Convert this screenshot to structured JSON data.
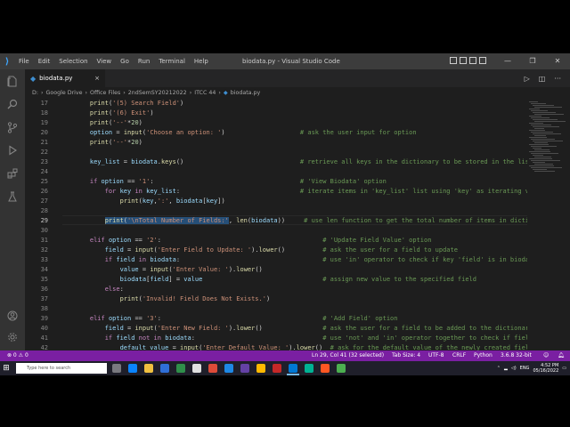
{
  "titlebar": {
    "menu": [
      "File",
      "Edit",
      "Selection",
      "View",
      "Go",
      "Run",
      "Terminal",
      "Help"
    ],
    "window_title": "biodata.py - Visual Studio Code",
    "minimize": "—",
    "maximize": "❐",
    "close": "✕"
  },
  "tab": {
    "name": "biodata.py",
    "close": "×"
  },
  "breadcrumb": [
    "D:",
    "Google Drive",
    "Office Files",
    "2ndSemSY20212022",
    "ITCC 44",
    "biodata.py"
  ],
  "editor_actions": {
    "run": "▷",
    "more": "···"
  },
  "code": {
    "line_numbers": [
      "17",
      "18",
      "19",
      "20",
      "21",
      "22",
      "23",
      "24",
      "25",
      "26",
      "27",
      "28",
      "29",
      "30",
      "31",
      "32",
      "33",
      "34",
      "35",
      "36",
      "37",
      "38",
      "39",
      "40",
      "41",
      "42"
    ],
    "current_line": "29",
    "lines": [
      "    print('(5) Search Field')",
      "    print('(6) Exit')",
      "    print('--'*20)",
      "    option = input('Choose an option: ')                    # ask the user input for option",
      "    print('--'*20)",
      "",
      "    key_list = biodata.keys()                               # retrieve all keys in the dictionary to be stored in the list",
      "",
      "    if option == '1':                                       # 'View Biodata' option",
      "        for key in key_list:                                # iterate items in 'key_list' list using 'key' as iterating variable",
      "            print(key,':', biodata[key])",
      "",
      "        print('\\nTotal Number of Fields:', len(biodata))     # use len function to get the total number of items in dictionary",
      "",
      "    elif option == '2':                                           # 'Update Field Value' option",
      "        field = input('Enter Field to Update: ').lower()          # ask the user for a field to update",
      "        if field in biodata:                                      # use 'in' operator to check if key 'field' is in biodata",
      "            value = input('Enter Value: ').lower()",
      "            biodata[field] = value                                # assign new value to the specified field",
      "        else:",
      "            print('Invalid! Field Does Not Exists.')",
      "",
      "    elif option == '3':                                           # 'Add Field' option",
      "        field = input('Enter New Field: ').lower()                # ask the user for a field to be added to the dictionary",
      "        if field not in biodata:                                  # use 'not' and 'in' operator together to check if field is not in biodata",
      "            default_value = input('Enter Default Value: ').lower()  # ask for the default value of the newly created field"
    ]
  },
  "statusbar": {
    "remote": "⊗ 0 ⚠ 0",
    "position": "Ln 29, Col 41 (32 selected)",
    "tab_size": "Tab Size: 4",
    "encoding": "UTF-8",
    "eol": "CRLF",
    "language": "Python",
    "interpreter": "3.6.8 32-bit"
  },
  "taskbar": {
    "search_placeholder": "Type here to search",
    "time": "4:52 PM",
    "date": "05/16/2022",
    "lang": "ENG"
  },
  "colors": {
    "statusbar": "#7a1fa2",
    "accent": "#3ea6ff"
  }
}
